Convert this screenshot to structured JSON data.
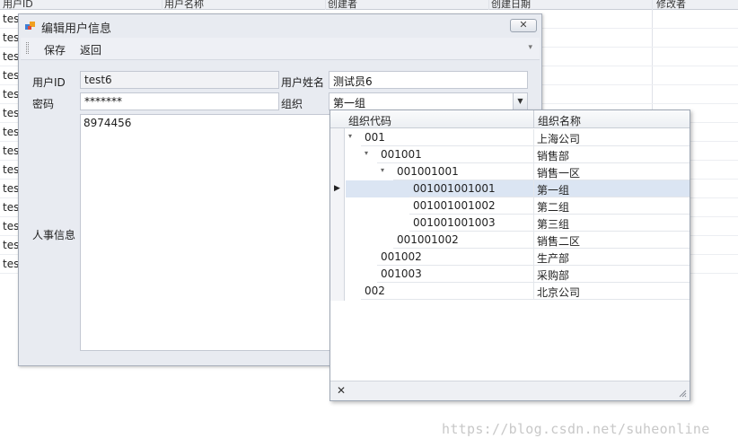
{
  "background_grid": {
    "columns": [
      "用户ID",
      "用户名称",
      "创建者",
      "创建日期",
      "修改者"
    ],
    "rows": [
      "tes",
      "tes",
      "tes",
      "tes",
      "tes",
      "tes",
      "tes",
      "tes",
      "tes",
      "tes",
      "tes",
      "tes",
      "tes",
      "tes"
    ]
  },
  "dialog": {
    "title": "编辑用户信息",
    "close_label": "✕",
    "toolbar": {
      "save_label": "保存",
      "back_label": "返回",
      "more_glyph": "▾"
    },
    "form": {
      "user_id_label": "用户ID",
      "user_id_value": "test6",
      "user_name_label": "用户姓名",
      "user_name_value": "测试员6",
      "password_label": "密码",
      "password_value": "*******",
      "org_label": "组织",
      "org_value": "第一组",
      "hr_label": "人事信息",
      "hr_value": "8974456"
    }
  },
  "org_popup": {
    "columns": {
      "code": "组织代码",
      "name": "组织名称"
    },
    "rows": [
      {
        "code": "001",
        "name": "上海公司",
        "expanded": "▾"
      },
      {
        "code": "001001",
        "name": "销售部",
        "expanded": "▾"
      },
      {
        "code": "001001001",
        "name": "销售一区",
        "expanded": "▾"
      },
      {
        "code": "001001001001",
        "name": "第一组",
        "expanded": "",
        "selected": true
      },
      {
        "code": "001001001002",
        "name": "第二组",
        "expanded": ""
      },
      {
        "code": "001001001003",
        "name": "第三组",
        "expanded": ""
      },
      {
        "code": "001001002",
        "name": "销售二区",
        "expanded": ""
      },
      {
        "code": "001002",
        "name": "生产部",
        "expanded": ""
      },
      {
        "code": "001003",
        "name": "采购部",
        "expanded": ""
      },
      {
        "code": "002",
        "name": "北京公司",
        "expanded": ""
      }
    ],
    "row_indicator": "▶",
    "close_label": "✕"
  },
  "watermark": "https://blog.csdn.net/suheonline"
}
